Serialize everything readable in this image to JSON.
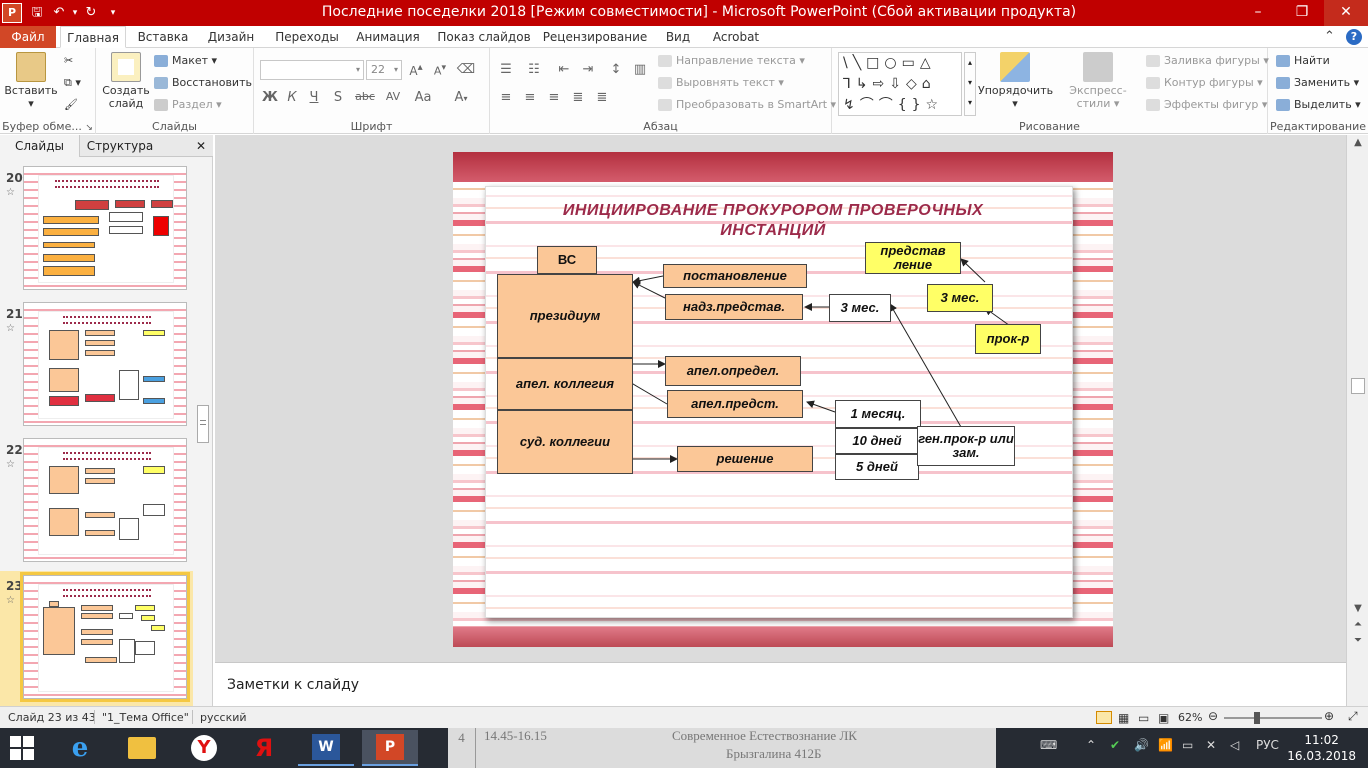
{
  "titlebar": {
    "title": "Последние поседелки 2018 [Режим совместимости] - Microsoft PowerPoint (Сбой активации продукта)",
    "app_icon_letter": "P",
    "minimize": "–",
    "maximize": "❐",
    "close": "✕"
  },
  "tabs": {
    "file": "Файл",
    "items": [
      "Главная",
      "Вставка",
      "Дизайн",
      "Переходы",
      "Анимация",
      "Показ слайдов",
      "Рецензирование",
      "Вид",
      "Acrobat"
    ],
    "active": "Главная"
  },
  "ribbon": {
    "clipboard": {
      "label": "Буфер обме...",
      "paste": "Вставить"
    },
    "slides": {
      "label": "Слайды",
      "new_slide": "Создать слайд",
      "layout": "Макет",
      "reset": "Восстановить",
      "section": "Раздел"
    },
    "font": {
      "label": "Шрифт",
      "font_name": "",
      "font_size": "22",
      "bold": "Ж",
      "italic": "К",
      "underline": "Ч",
      "shadow": "S",
      "strike": "abc",
      "spacing": "AV",
      "case": "Aa"
    },
    "paragraph": {
      "label": "Абзац",
      "text_direction": "Направление текста",
      "align_text": "Выровнять текст",
      "smartart": "Преобразовать в SmartArt"
    },
    "drawing": {
      "label": "Рисование",
      "arrange": "Упорядочить",
      "quick_styles": "Экспресс-стили",
      "fill": "Заливка фигуры",
      "outline": "Контур фигуры",
      "effects": "Эффекты фигур"
    },
    "editing": {
      "label": "Редактирование",
      "find": "Найти",
      "replace": "Заменить",
      "select": "Выделить"
    }
  },
  "leftpane": {
    "tab_slides": "Слайды",
    "tab_outline": "Структура",
    "close": "✕",
    "thumbs": [
      {
        "num": "20"
      },
      {
        "num": "21"
      },
      {
        "num": "22"
      },
      {
        "num": "23"
      }
    ]
  },
  "slide": {
    "title_line1": "ИНИЦИИРОВАНИЕ   ПРОКУРОРОМ  ПРОВЕРОЧНЫХ",
    "title_line2": "ИНСТАНЦИЙ",
    "boxes": {
      "vs": "ВС",
      "presidium": "президиум",
      "apel_kollegia": "апел.  коллегия",
      "sud_kollegii": "суд. коллегии",
      "postanovlenie": "постановление",
      "nadz_predstav": "надз.представ.",
      "apel_opredel": "апел.определ.",
      "apel_predst": "апел.предст.",
      "reshenie": "решение",
      "three_mes": "3 мес.",
      "predstavlenie": "представ ление",
      "three_mes_yellow": "3 мес.",
      "prok_r": "прок-р",
      "one_mesyac": "1 месяц.",
      "ten_dney": "10 дней",
      "five_dney": "5 дней",
      "gen_prok": "ген.прок-р или зам."
    }
  },
  "notes": {
    "placeholder": "Заметки к слайду"
  },
  "status": {
    "slide_info": "Слайд 23 из 43",
    "theme": "\"1_Тема Office\"",
    "language": "русский",
    "zoom": "62%",
    "zoom_level": 0.62
  },
  "taskbar": {
    "language": "РУС",
    "time": "11:02",
    "date": "16.03.2018",
    "bg_text1": "14.45-16.15",
    "bg_text2": "Современное Естествознание ЛК",
    "bg_text3": "Брызгалина 412Б",
    "bg_num": "4"
  },
  "colors": {
    "title_bar": "#c00000",
    "file_tab": "#d24726",
    "slide_title": "#9c2a4a",
    "box_orange": "#fbc797",
    "box_yellow": "#ffff66",
    "thumb_selected": "#f5c842"
  }
}
